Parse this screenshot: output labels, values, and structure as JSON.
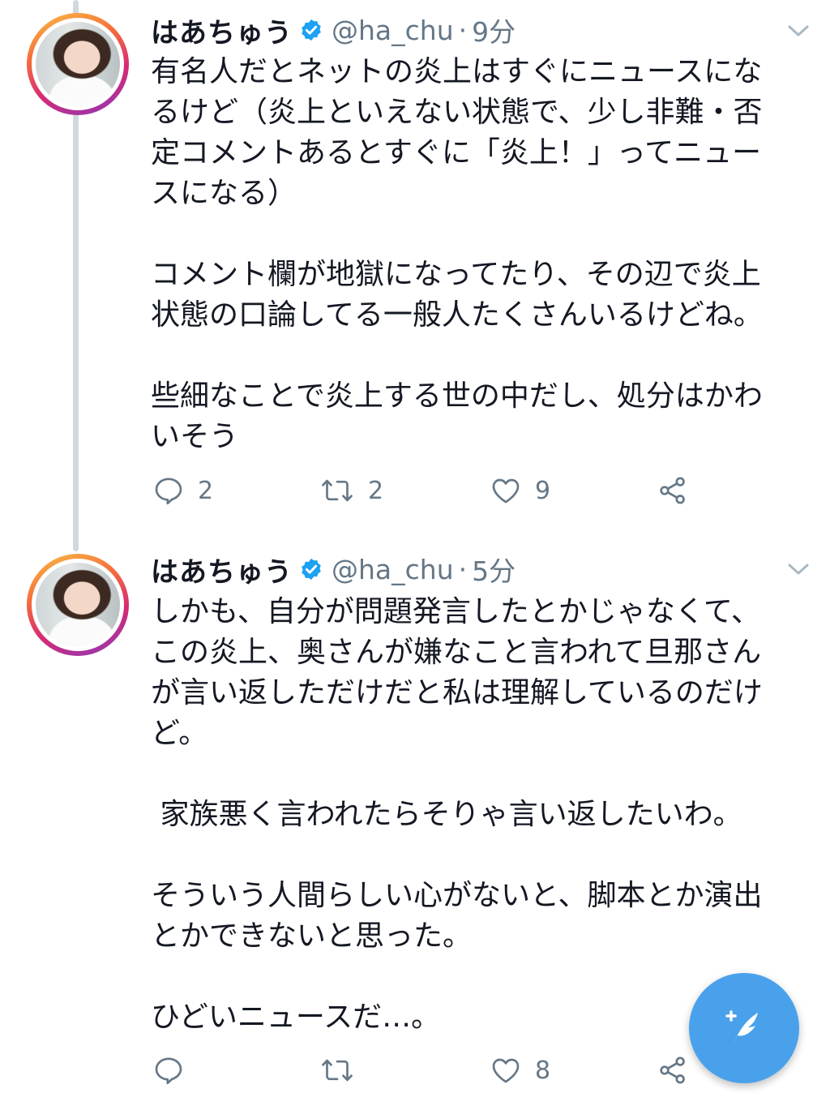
{
  "tweets": [
    {
      "name": "はあちゅう",
      "handle": "@ha_chu",
      "separator": "·",
      "time": "9分",
      "paragraphs": [
        [
          "有名人だとネットの炎上はすぐにニュースにな",
          "るけど（炎上といえない状態で、少し非難・否",
          "定コメントあるとすぐに「炎上！」ってニュー",
          "スになる）"
        ],
        [
          "コメント欄が地獄になってたり、その辺で炎上",
          "状態の口論してる一般人たくさんいるけどね。"
        ],
        [
          "些細なことで炎上する世の中だし、処分はかわ",
          "いそう"
        ]
      ],
      "reply_count": "2",
      "retweet_count": "2",
      "like_count": "9"
    },
    {
      "name": "はあちゅう",
      "handle": "@ha_chu",
      "separator": "·",
      "time": "5分",
      "paragraphs": [
        [
          "しかも、自分が問題発言したとかじゃなくて、",
          "この炎上、奥さんが嫌なこと言われて旦那さん",
          "が言い返しただけだと私は理解しているのだけ",
          "ど。"
        ],
        [
          " 家族悪く言われたらそりゃ言い返したいわ。"
        ],
        [
          "そういう人間らしい心がないと、脚本とか演出",
          "とかできないと思った。"
        ],
        [
          "ひどいニュースだ…。"
        ]
      ],
      "reply_count": "",
      "retweet_count": "",
      "like_count": "8"
    }
  ],
  "icons": {
    "verified": "verified-badge-icon",
    "caret": "chevron-down-icon",
    "reply": "reply-icon",
    "retweet": "retweet-icon",
    "like": "heart-icon",
    "share": "share-icon",
    "compose": "compose-tweet-icon"
  },
  "colors": {
    "accent": "#4aa1eb",
    "verified": "#1da1f2",
    "muted": "#657786",
    "thread_line": "#cfd9de"
  }
}
